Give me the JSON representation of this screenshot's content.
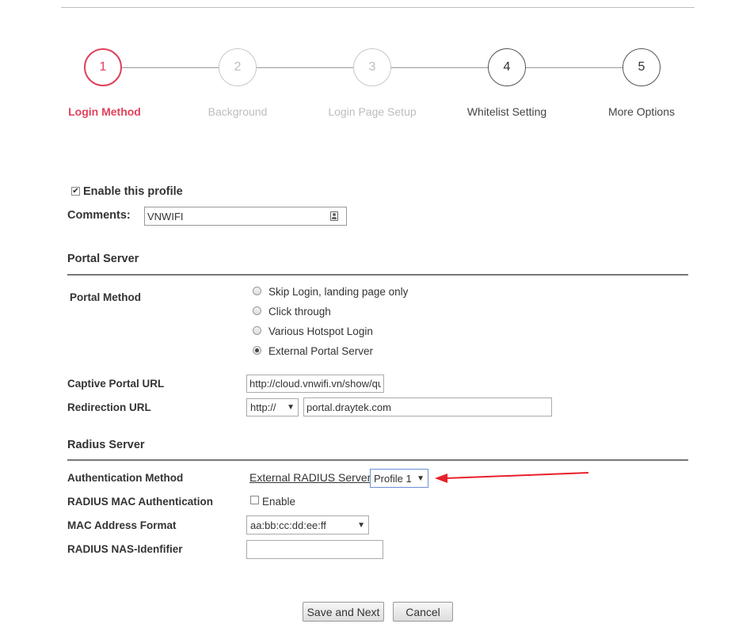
{
  "stepper": {
    "steps": [
      {
        "number": "1",
        "label": "Login Method",
        "state": "active"
      },
      {
        "number": "2",
        "label": "Background",
        "state": "disabled"
      },
      {
        "number": "3",
        "label": "Login Page Setup",
        "state": "disabled"
      },
      {
        "number": "4",
        "label": "Whitelist Setting",
        "state": "normal"
      },
      {
        "number": "5",
        "label": "More Options",
        "state": "normal"
      }
    ],
    "colors": {
      "active": "#e0425c",
      "disabled": "#c8c8c8",
      "normal": "#333333"
    }
  },
  "profile": {
    "enable_label": "Enable this profile",
    "enable_checked": true,
    "comments_label": "Comments:",
    "comments_value": "VNWIFI",
    "field_icon": "contact-card-icon"
  },
  "portal_server": {
    "title": "Portal Server",
    "method_label": "Portal Method",
    "options": [
      {
        "label": "Skip Login, landing page only",
        "checked": false
      },
      {
        "label": "Click through",
        "checked": false
      },
      {
        "label": "Various Hotspot Login",
        "checked": false
      },
      {
        "label": "External Portal Server",
        "checked": true
      }
    ],
    "captive_url_label": "Captive Portal URL",
    "captive_url_value": "http://cloud.vnwifi.vn/show/qu",
    "redirection_label": "Redirection URL",
    "redirection_protocol": "http://",
    "redirection_value": "portal.draytek.com"
  },
  "radius_server": {
    "title": "Radius Server",
    "auth_method_label": "Authentication Method",
    "auth_method_link": "External RADIUS Server",
    "auth_profile": "Profile 1",
    "mac_auth_label": "RADIUS MAC Authentication",
    "mac_auth_option": "Enable",
    "mac_auth_checked": false,
    "mac_format_label": "MAC Address Format",
    "mac_format_value": "aa:bb:cc:dd:ee:ff",
    "nas_label": "RADIUS NAS-Idenfifier",
    "nas_value": ""
  },
  "annotation": {
    "arrow_color": "#e8202a"
  },
  "buttons": {
    "save_next": "Save and Next",
    "cancel": "Cancel"
  }
}
